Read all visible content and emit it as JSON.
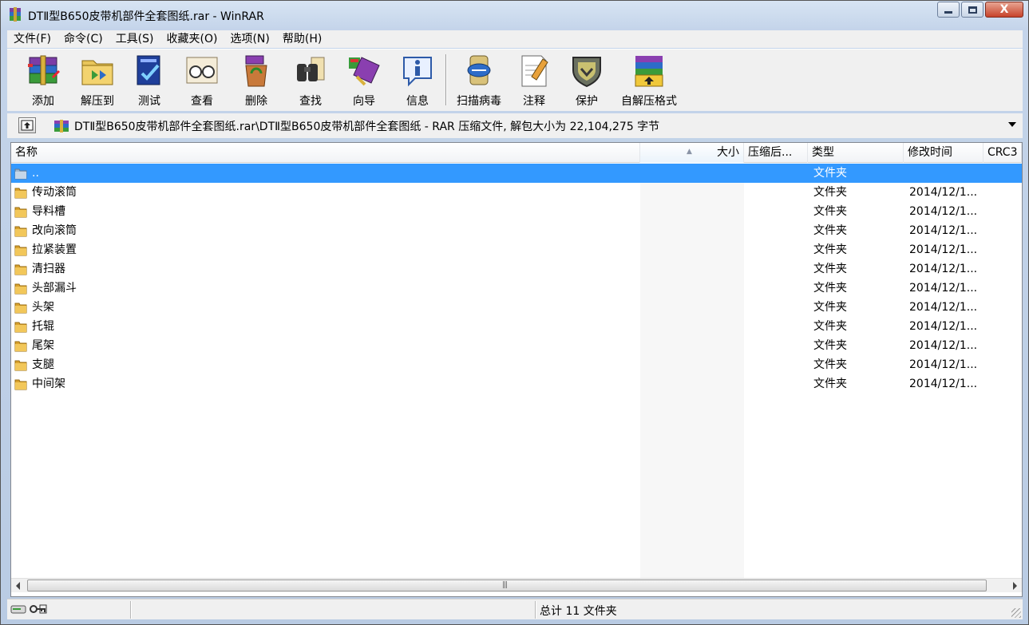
{
  "window": {
    "title": "DTⅡ型B650皮带机部件全套图纸.rar - WinRAR",
    "close_glyph": "X"
  },
  "menu": [
    {
      "label": "文件(F)"
    },
    {
      "label": "命令(C)"
    },
    {
      "label": "工具(S)"
    },
    {
      "label": "收藏夹(O)"
    },
    {
      "label": "选项(N)"
    },
    {
      "label": "帮助(H)"
    }
  ],
  "toolbar": {
    "add": "添加",
    "extract": "解压到",
    "test": "测试",
    "view": "查看",
    "delete": "删除",
    "find": "查找",
    "wizard": "向导",
    "info": "信息",
    "scan": "扫描病毒",
    "comment": "注释",
    "protect": "保护",
    "sfx": "自解压格式"
  },
  "address": {
    "path": "DTⅡ型B650皮带机部件全套图纸.rar\\DTⅡ型B650皮带机部件全套图纸 - RAR 压缩文件, 解包大小为 22,104,275 字节"
  },
  "columns": {
    "name": "名称",
    "size": "大小",
    "packed": "压缩后...",
    "type": "类型",
    "modified": "修改时间",
    "crc": "CRC3"
  },
  "rows": [
    {
      "name": "..",
      "type": "文件夹",
      "modified": ""
    },
    {
      "name": "传动滚筒",
      "type": "文件夹",
      "modified": "2014/12/1..."
    },
    {
      "name": "导料槽",
      "type": "文件夹",
      "modified": "2014/12/1..."
    },
    {
      "name": "改向滚筒",
      "type": "文件夹",
      "modified": "2014/12/1..."
    },
    {
      "name": "拉紧装置",
      "type": "文件夹",
      "modified": "2014/12/1..."
    },
    {
      "name": "清扫器",
      "type": "文件夹",
      "modified": "2014/12/1..."
    },
    {
      "name": "头部漏斗",
      "type": "文件夹",
      "modified": "2014/12/1..."
    },
    {
      "name": "头架",
      "type": "文件夹",
      "modified": "2014/12/1..."
    },
    {
      "name": "托辊",
      "type": "文件夹",
      "modified": "2014/12/1..."
    },
    {
      "name": "尾架",
      "type": "文件夹",
      "modified": "2014/12/1..."
    },
    {
      "name": "支腿",
      "type": "文件夹",
      "modified": "2014/12/1..."
    },
    {
      "name": "中间架",
      "type": "文件夹",
      "modified": "2014/12/1..."
    }
  ],
  "status": {
    "summary": "总计 11 文件夹"
  },
  "colors": {
    "selection": "#3399ff",
    "folder": "#e8b94a"
  }
}
